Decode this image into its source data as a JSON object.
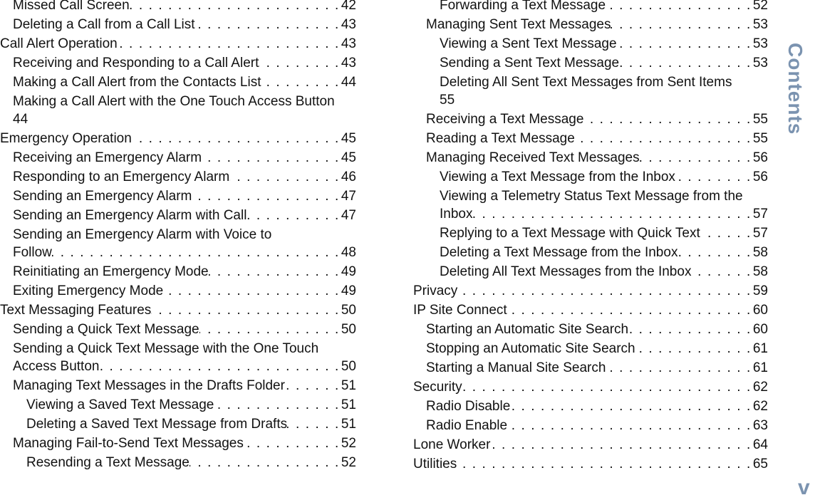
{
  "section_tab": "Contents",
  "page_number": "v",
  "accent_color": "#7b93b0",
  "left_column": [
    {
      "level": 1,
      "title": "Missed Call Screen",
      "page": "42"
    },
    {
      "level": 1,
      "title": "Deleting a Call from a Call List",
      "page": "43"
    },
    {
      "level": 0,
      "title": "Call Alert Operation",
      "page": "43"
    },
    {
      "level": 1,
      "title": "Receiving and Responding to a Call Alert",
      "page": "43"
    },
    {
      "level": 1,
      "title": "Making a Call Alert from the Contacts List",
      "page": "44"
    },
    {
      "level": 1,
      "title": "Making a Call Alert with the One Touch Access Button",
      "page": "44",
      "wrap_page": true
    },
    {
      "level": 0,
      "title": "Emergency Operation",
      "page": "45"
    },
    {
      "level": 1,
      "title": "Receiving an Emergency Alarm",
      "page": "45"
    },
    {
      "level": 1,
      "title": "Responding to an Emergency Alarm",
      "page": "46"
    },
    {
      "level": 1,
      "title": "Sending an Emergency Alarm",
      "page": "47"
    },
    {
      "level": 1,
      "title": "Sending an Emergency Alarm with Call",
      "page": "47"
    },
    {
      "level": 1,
      "title": "Sending an Emergency Alarm with Voice to",
      "cont": "Follow",
      "page": "48"
    },
    {
      "level": 1,
      "title": "Reinitiating an Emergency Mode",
      "page": "49"
    },
    {
      "level": 1,
      "title": "Exiting Emergency Mode",
      "page": "49"
    },
    {
      "level": 0,
      "title": "Text Messaging Features",
      "page": "50"
    },
    {
      "level": 1,
      "title": "Sending a Quick Text Message",
      "page": "50"
    },
    {
      "level": 1,
      "title": "Sending a Quick Text Message with the One Touch",
      "cont": "Access Button",
      "page": "50"
    },
    {
      "level": 1,
      "title": "Managing Text Messages in the Drafts Folder",
      "page": "51"
    },
    {
      "level": 2,
      "title": "Viewing a Saved Text Message",
      "page": "51"
    },
    {
      "level": 2,
      "title": "Deleting a Saved Text Message from Drafts",
      "page": "51"
    },
    {
      "level": 1,
      "title": "Managing Fail-to-Send Text Messages",
      "page": "52"
    },
    {
      "level": 2,
      "title": "Resending a Text Message",
      "page": "52"
    }
  ],
  "right_column": [
    {
      "level": 2,
      "title": "Forwarding a Text Message",
      "page": "52"
    },
    {
      "level": 1,
      "title": "Managing Sent Text Messages",
      "page": "53"
    },
    {
      "level": 2,
      "title": "Viewing a Sent Text Message",
      "page": "53"
    },
    {
      "level": 2,
      "title": "Sending a Sent Text Message",
      "page": "53"
    },
    {
      "level": 2,
      "title": "Deleting All Sent Text Messages from Sent Items",
      "page": "55",
      "wrap_page": true
    },
    {
      "level": 1,
      "title": "Receiving a Text Message",
      "page": "55"
    },
    {
      "level": 1,
      "title": "Reading a Text Message",
      "page": "55"
    },
    {
      "level": 1,
      "title": "Managing Received Text Messages",
      "page": "56"
    },
    {
      "level": 2,
      "title": "Viewing a Text Message from the Inbox",
      "page": "56"
    },
    {
      "level": 2,
      "title": "Viewing a Telemetry Status Text Message from the",
      "cont": "Inbox",
      "page": "57"
    },
    {
      "level": 2,
      "title": "Replying to a Text Message with Quick Text",
      "page": "57"
    },
    {
      "level": 2,
      "title": "Deleting a Text Message from the Inbox",
      "page": "58"
    },
    {
      "level": 2,
      "title": "Deleting All Text Messages from the Inbox",
      "page": "58"
    },
    {
      "level": 0,
      "title": "Privacy",
      "page": "59"
    },
    {
      "level": 0,
      "title": "IP Site Connect",
      "page": "60"
    },
    {
      "level": 1,
      "title": "Starting an Automatic Site Search",
      "page": "60"
    },
    {
      "level": 1,
      "title": "Stopping an Automatic Site Search",
      "page": "61"
    },
    {
      "level": 1,
      "title": "Starting a Manual Site Search",
      "page": "61"
    },
    {
      "level": 0,
      "title": "Security",
      "page": "62"
    },
    {
      "level": 1,
      "title": "Radio Disable",
      "page": "62"
    },
    {
      "level": 1,
      "title": "Radio Enable",
      "page": "63"
    },
    {
      "level": 0,
      "title": "Lone Worker",
      "page": "64"
    },
    {
      "level": 0,
      "title": "Utilities",
      "page": "65"
    }
  ]
}
